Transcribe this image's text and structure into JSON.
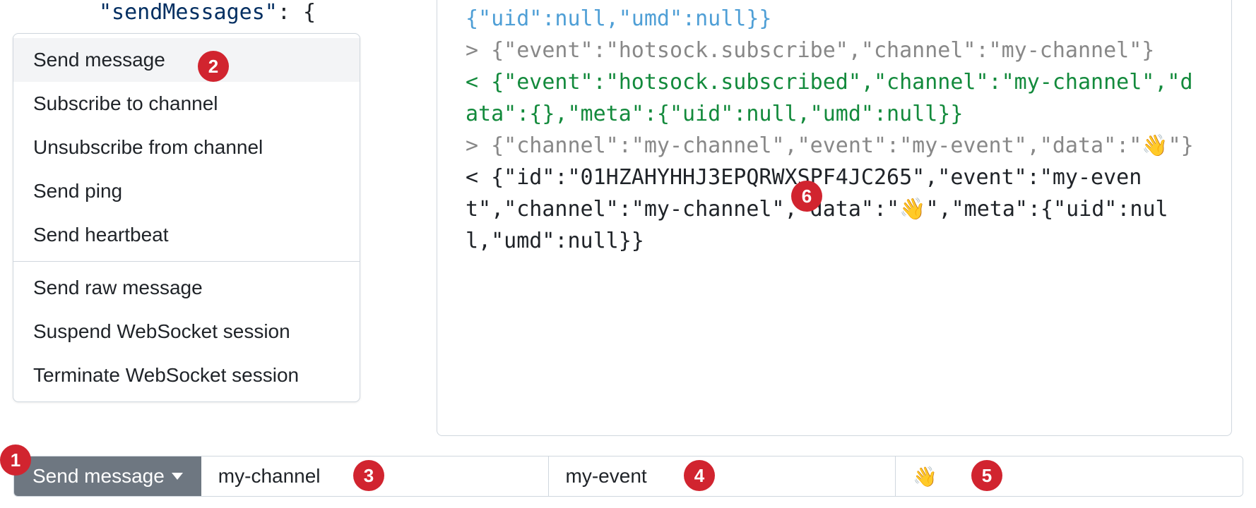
{
  "code_fragment": {
    "key_text": "\"sendMessages\"",
    "suffix": ": {"
  },
  "menu": {
    "section1": [
      {
        "label": "Send message",
        "selected": true
      },
      {
        "label": "Subscribe to channel",
        "selected": false
      },
      {
        "label": "Unsubscribe from channel",
        "selected": false
      },
      {
        "label": "Send ping",
        "selected": false
      },
      {
        "label": "Send heartbeat",
        "selected": false
      }
    ],
    "section2": [
      {
        "label": "Send raw message"
      },
      {
        "label": "Suspend WebSocket session"
      },
      {
        "label": "Terminate WebSocket session"
      }
    ]
  },
  "log": {
    "lines": [
      {
        "cls": "c-blue",
        "text": "{\"uid\":null,\"umd\":null}}"
      },
      {
        "cls": "c-gray",
        "text": "> {\"event\":\"hotsock.subscribe\",\"channel\":\"my-channel\"}"
      },
      {
        "cls": "c-green",
        "text": "< {\"event\":\"hotsock.subscribed\",\"channel\":\"my-channel\",\"data\":{},\"meta\":{\"uid\":null,\"umd\":null}}"
      },
      {
        "cls": "c-gray",
        "text": "> {\"channel\":\"my-channel\",\"event\":\"my-event\",\"data\":\"👋\"}"
      },
      {
        "cls": "c-black",
        "text": "< {\"id\":\"01HZAHYHHJ3EPQRWXSPF4JC265\",\"event\":\"my-event\",\"channel\":\"my-channel\",\"data\":\"👋\",\"meta\":{\"uid\":null,\"umd\":null}}"
      }
    ]
  },
  "toolbar": {
    "button_label": "Send message",
    "channel": "my-channel",
    "event": "my-event",
    "data": "👋"
  },
  "badges": {
    "b1": "1",
    "b2": "2",
    "b3": "3",
    "b4": "4",
    "b5": "5",
    "b6": "6"
  }
}
